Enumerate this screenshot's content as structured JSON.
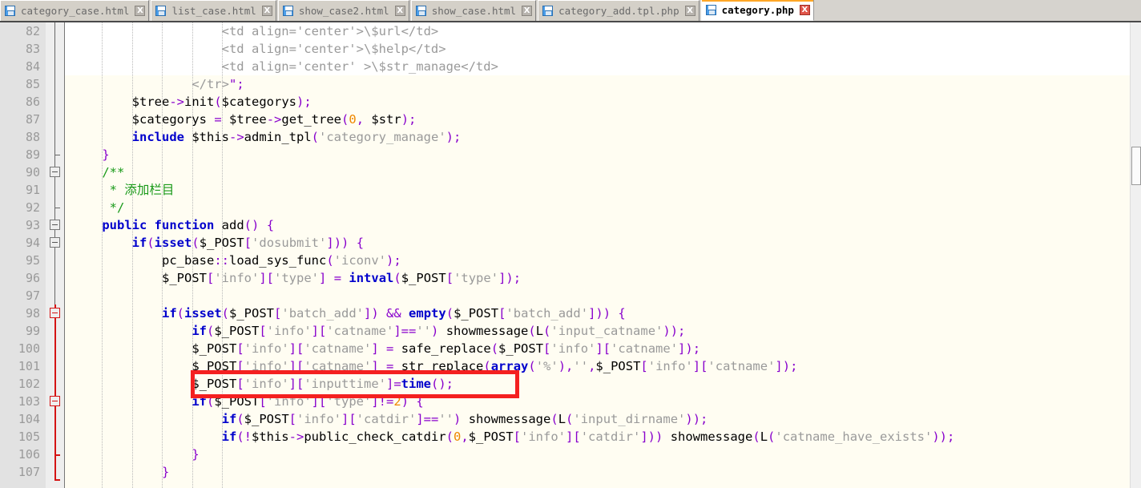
{
  "window": {
    "app": "code-editor",
    "accent_color": "#ffa726",
    "annotation_color": "#f42020",
    "current_line_color": "#e2e3f7",
    "editor_background": "#fffdf2",
    "gutter_background": "#e2e2e2"
  },
  "tabs": [
    {
      "label": "category_case.html",
      "icon": "save-floppy-icon",
      "close": "X",
      "active": false
    },
    {
      "label": "list_case.html",
      "icon": "save-floppy-icon",
      "close": "X",
      "active": false
    },
    {
      "label": "show_case2.html",
      "icon": "save-floppy-icon",
      "close": "X",
      "active": false
    },
    {
      "label": "show_case.html",
      "icon": "save-floppy-icon",
      "close": "X",
      "active": false
    },
    {
      "label": "category_add.tpl.php",
      "icon": "save-floppy-icon",
      "close": "X",
      "active": false
    },
    {
      "label": "category.php",
      "icon": "save-floppy-icon",
      "close": "X",
      "active": true
    }
  ],
  "editor": {
    "first_line_number": 82,
    "current_line_number": 102,
    "line_numbers": [
      "82",
      "83",
      "84",
      "85",
      "86",
      "87",
      "88",
      "89",
      "90",
      "91",
      "92",
      "93",
      "94",
      "95",
      "96",
      "97",
      "98",
      "99",
      "100",
      "101",
      "102",
      "103",
      "104",
      "105",
      "106",
      "107"
    ],
    "fold_markers": [
      {
        "line": "90",
        "type": "box",
        "color": "gray"
      },
      {
        "line": "93",
        "type": "box",
        "color": "gray"
      },
      {
        "line": "94",
        "type": "box",
        "color": "gray"
      },
      {
        "line": "98",
        "type": "box",
        "color": "red"
      },
      {
        "line": "103",
        "type": "box",
        "color": "red"
      },
      {
        "line": "106",
        "type": "tick",
        "color": "red"
      },
      {
        "line": "107",
        "type": "end",
        "color": "red"
      }
    ],
    "lines": [
      "                    <td align='center'>\\$url</td>",
      "                    <td align='center'>\\$help</td>",
      "                    <td align='center' >\\$str_manage</td>",
      "                </tr>\";",
      "        $tree->init($categorys);",
      "        $categorys = $tree->get_tree(0, $str);",
      "        include $this->admin_tpl('category_manage');",
      "    }",
      "    /**",
      "     * 添加栏目",
      "     */",
      "    public function add() {",
      "        if(isset($_POST['dosubmit'])) {",
      "            pc_base::load_sys_func('iconv');",
      "            $_POST['info']['type'] = intval($_POST['type']);",
      "",
      "            if(isset($_POST['batch_add']) && empty($_POST['batch_add'])) {",
      "                if($_POST['info']['catname']=='') showmessage(L('input_catname'));",
      "                $_POST['info']['catname'] = safe_replace($_POST['info']['catname']);",
      "                $_POST['info']['catname'] = str_replace(array('%'),'',$_POST['info']['catname']);",
      "                $_POST['info']['inputtime']=time();",
      "                if($_POST['info']['type']!=2) {",
      "                    if($_POST['info']['catdir']=='') showmessage(L('input_dirname'));",
      "                    if(!$this->public_check_catdir(0,$_POST['info']['catdir'])) showmessage(L('catname_have_exists'));",
      "                }",
      "            }"
    ],
    "annotation": {
      "type": "red-rectangle",
      "target_line": "102",
      "target_code": "$_POST['info']['inputtime']=time();"
    },
    "caret": {
      "line": "102",
      "column": 17
    }
  }
}
